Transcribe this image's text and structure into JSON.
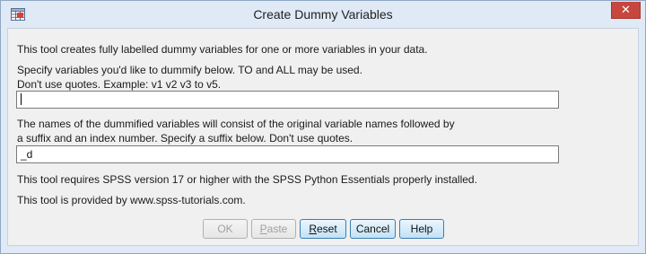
{
  "window": {
    "title": "Create Dummy Variables",
    "close_glyph": "✕",
    "icon": "spss-app-icon"
  },
  "text": {
    "intro": "This tool creates fully labelled dummy variables for one or more variables in your data.",
    "specify_line1": "Specify variables you'd like to dummify below. TO and ALL may be used.",
    "specify_line2": "Don't use quotes. Example: v1 v2 v3 to v5.",
    "names_line1": "The names of the dummified variables will consist of the original variable names followed by",
    "names_line2": "a suffix and an index number. Specify a suffix below. Don't use quotes.",
    "requires": "This tool requires SPSS version 17 or higher with the SPSS Python Essentials properly installed.",
    "provided": "This tool is provided by www.spss-tutorials.com."
  },
  "fields": {
    "variables_value": "",
    "suffix_value": "_d"
  },
  "buttons": {
    "ok": "OK",
    "paste_p": "P",
    "paste_rest": "aste",
    "reset_r": "R",
    "reset_rest": "eset",
    "cancel": "Cancel",
    "help": "Help"
  }
}
